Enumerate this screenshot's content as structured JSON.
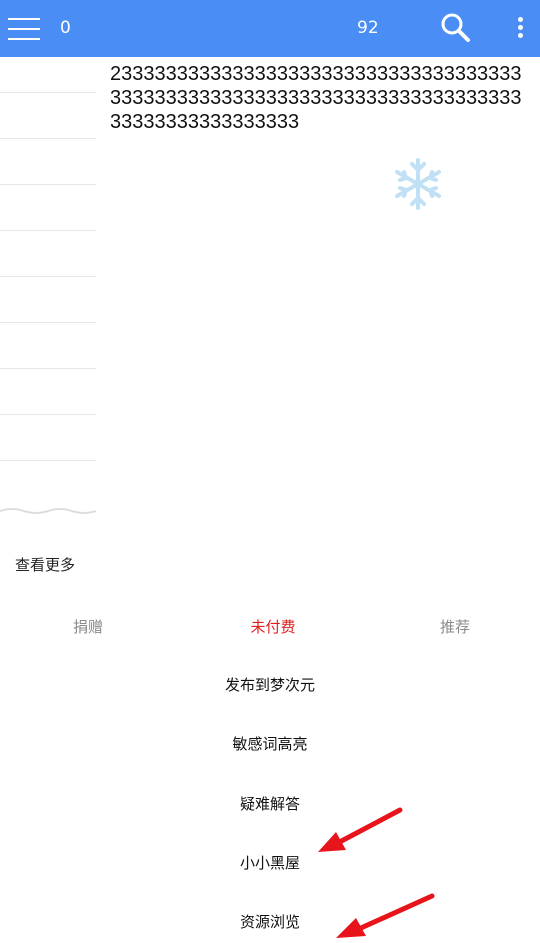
{
  "header": {
    "left_count": "0",
    "right_count": "92",
    "icons": [
      "menu-icon",
      "search-icon",
      "more-vert-icon"
    ],
    "color": "#4a8ef5"
  },
  "content": {
    "text": "2333333333333333333333333333333333333333333333333333333333333333333333333333333333333333333"
  },
  "sidebar": {
    "more_label": "查看更多"
  },
  "tabs": [
    {
      "label": "捐赠",
      "active": false
    },
    {
      "label": "未付费",
      "active": true
    },
    {
      "label": "推荐",
      "active": false
    }
  ],
  "menu": [
    {
      "label": "发布到梦次元"
    },
    {
      "label": "敏感词高亮"
    },
    {
      "label": "疑难解答"
    },
    {
      "label": "小小黑屋"
    },
    {
      "label": "资源浏览"
    }
  ],
  "annotation_color": "#e8141c"
}
